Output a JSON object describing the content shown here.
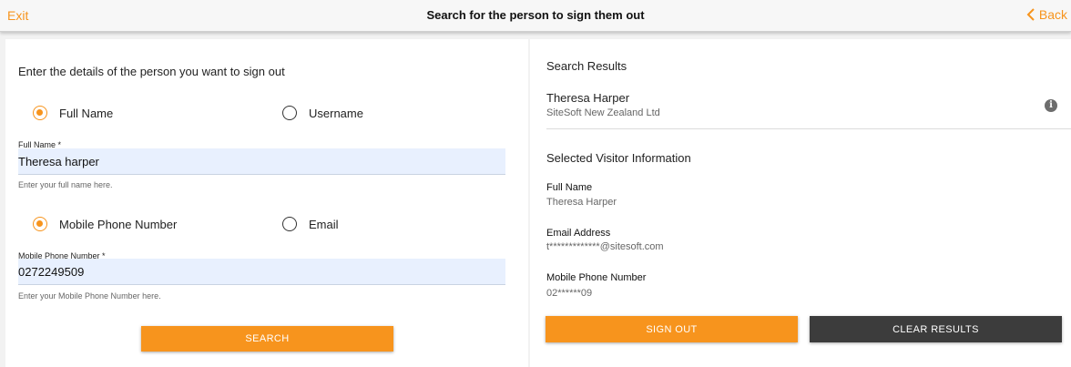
{
  "header": {
    "exit_label": "Exit",
    "title": "Search for the person to sign them out",
    "back_label": "Back"
  },
  "search_form": {
    "heading": "Enter the details of the person you want to sign out",
    "name_options": [
      {
        "label": "Full Name",
        "selected": true
      },
      {
        "label": "Username",
        "selected": false
      }
    ],
    "full_name": {
      "label": "Full Name *",
      "value": "Theresa harper",
      "hint": "Enter your full name here."
    },
    "contact_options": [
      {
        "label": "Mobile Phone Number",
        "selected": true
      },
      {
        "label": "Email",
        "selected": false
      }
    ],
    "mobile": {
      "label": "Mobile Phone Number *",
      "value": "0272249509",
      "hint": "Enter your Mobile Phone Number here."
    },
    "search_label": "SEARCH"
  },
  "results": {
    "heading": "Search Results",
    "items": [
      {
        "name": "Theresa Harper",
        "company": "SiteSoft New Zealand Ltd"
      }
    ],
    "info_icon": "info-icon"
  },
  "selected_visitor": {
    "heading": "Selected Visitor Information",
    "fields": [
      {
        "label": "Full Name",
        "value": "Theresa Harper"
      },
      {
        "label": "Email Address",
        "value": "t*************@sitesoft.com"
      },
      {
        "label": "Mobile Phone Number",
        "value": "02******09"
      }
    ]
  },
  "actions": {
    "sign_out_label": "SIGN OUT",
    "clear_label": "CLEAR RESULTS"
  },
  "colors": {
    "accent": "#f7941d",
    "dark_button": "#3c3c3c",
    "field_bg": "#e8f0fe"
  }
}
